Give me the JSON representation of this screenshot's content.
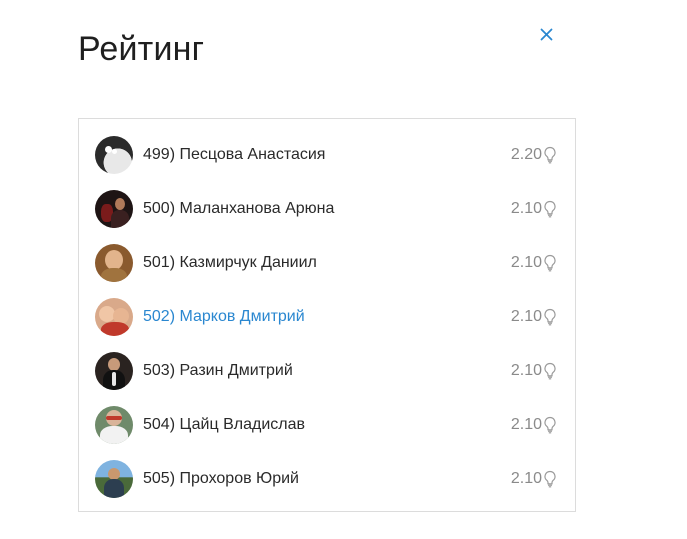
{
  "header": {
    "title": "Рейтинг"
  },
  "close_icon": "close-icon",
  "rating": {
    "score_icon": "lightbulb-icon",
    "accent_color": "#2a87d0",
    "rows": [
      {
        "rank_name": "499) Песцова Анастасия",
        "score": "2.20",
        "current": false
      },
      {
        "rank_name": "500) Маланханова Арюна",
        "score": "2.10",
        "current": false
      },
      {
        "rank_name": "501) Казмирчук Даниил",
        "score": "2.10",
        "current": false
      },
      {
        "rank_name": "502) Марков Дмитрий",
        "score": "2.10",
        "current": true
      },
      {
        "rank_name": "503) Разин Дмитрий",
        "score": "2.10",
        "current": false
      },
      {
        "rank_name": "504) Цайц Владислав",
        "score": "2.10",
        "current": false
      },
      {
        "rank_name": "505) Прохоров Юрий",
        "score": "2.10",
        "current": false
      }
    ]
  }
}
